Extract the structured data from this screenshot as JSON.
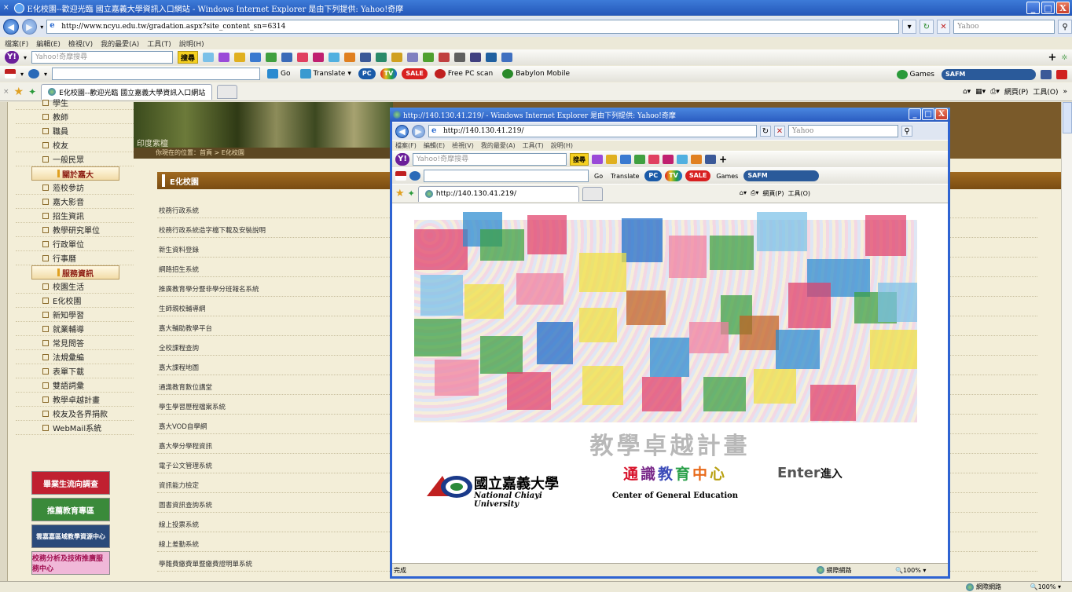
{
  "window": {
    "title": "E化校園--歡迎光臨 國立嘉義大學資訊入口網站 - Windows Internet Explorer 是由下列提供: Yahoo!奇摩",
    "min": "_",
    "max": "□",
    "close": "X"
  },
  "address": {
    "url": "http://www.ncyu.edu.tw/gradation.aspx?site_content_sn=6314",
    "search_placeholder": "Yahoo"
  },
  "menu": [
    "檔案(F)",
    "編輯(E)",
    "檢視(V)",
    "我的最愛(A)",
    "工具(T)",
    "說明(H)"
  ],
  "toolbar": {
    "search_placeholder": "Yahoo!奇摩搜尋",
    "search_btn": "搜尋",
    "go": "Go",
    "translate": "Translate",
    "pc_label": "PC",
    "tv_label": "TV",
    "sale_label": "SALE",
    "free_scan": "Free PC scan",
    "babylon": "Babylon Mobile",
    "games": "Games",
    "safm": "SAFM"
  },
  "tab": {
    "label": "E化校園--歡迎光臨 國立嘉義大學資訊入口網站"
  },
  "cmds": {
    "page": "網頁(P)",
    "tools": "工具(O)"
  },
  "sidebar": {
    "top_items": [
      "學生",
      "教師",
      "職員",
      "校友",
      "一般民眾"
    ],
    "section1": "關於嘉大",
    "items1": [
      "蒞校參訪",
      "嘉大影音",
      "招生資訊",
      "教學研究單位",
      "行政單位",
      "行事曆"
    ],
    "section2": "服務資訊",
    "items2": [
      "校園生活",
      "E化校園",
      "新知學習",
      "就業輔導",
      "常見問答",
      "法規彙編",
      "表單下載",
      "雙語詞彙",
      "教學卓越計畫",
      "校友及各界捐款",
      "WebMail系統"
    ]
  },
  "banner": {
    "caption": "印度紫檀",
    "crumb": "你現在的位置：首頁 > E化校園"
  },
  "content": {
    "title": "E化校園",
    "links": [
      "校務行政系統",
      "校務行政系統造字檔下載及安裝說明",
      "新生資料登錄",
      "網路招生系統",
      "推廣教育學分暨非學分班報名系統",
      "生師親校輔導網",
      "嘉大輔助教學平台",
      "全校課程查詢",
      "嘉大課程地圖",
      "通識教育數位講堂",
      "學生學習歷程檔案系統",
      "嘉大VOD自學網",
      "嘉大學分學程資訊",
      "電子公文管理系統",
      "資訊能力檢定",
      "圖書資訊查詢系統",
      "線上投票系統",
      "線上差勤系統",
      "學雜費繳費單暨繳費證明單系統"
    ]
  },
  "ads": [
    "畢業生流向調查",
    "推薦教育專區",
    "雲嘉嘉區域教學資源中心",
    "校務分析及技術推廣服務中心"
  ],
  "status": {
    "zone": "網際網路",
    "zoom": "100%"
  },
  "popup": {
    "title": "http://140.130.41.219/ - Windows Internet Explorer 是由下列提供: Yahoo!奇摩",
    "url": "http://140.130.41.219/",
    "search_placeholder": "Yahoo",
    "tab": "http://140.130.41.219/",
    "headline": "教學卓越計畫",
    "univ_cn": "國立嘉義大學",
    "univ_en": "National Chiayi University",
    "cge_cn": [
      "通",
      "識",
      "教",
      "育",
      "中",
      "心"
    ],
    "cge_en": "Center of General Education",
    "enter_en": "Enter",
    "enter_cn": "進入",
    "status_left": "完成",
    "zone": "網際網路",
    "zoom": "100%"
  },
  "colors": {
    "cge": [
      "#d8122a",
      "#7a2a8a",
      "#3a4ab8",
      "#2aa04a",
      "#e86a1a",
      "#b8a010"
    ]
  }
}
